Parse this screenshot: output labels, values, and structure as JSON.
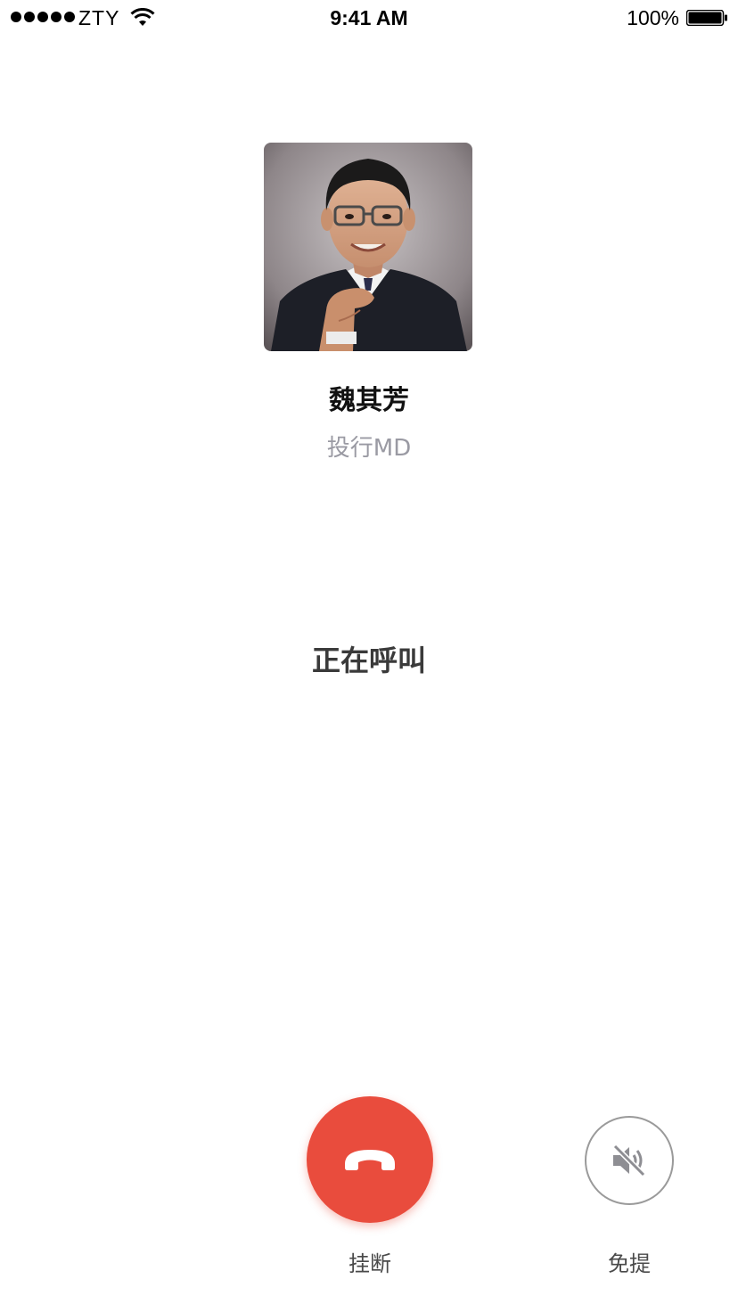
{
  "status_bar": {
    "carrier": "ZTY",
    "time": "9:41 AM",
    "battery_percent": "100%",
    "signal_bars": 5,
    "battery_level": 1.0,
    "icons": [
      "signal-icon",
      "wifi-icon",
      "battery-icon"
    ]
  },
  "caller": {
    "name": "魏其芳",
    "title": "投行MD",
    "avatar": "avatar-photo"
  },
  "call": {
    "status": "正在呼叫"
  },
  "controls": {
    "hangup_label": "挂断",
    "speaker_label": "免提",
    "hangup_icon": "phone-hangup-icon",
    "speaker_icon": "speaker-muted-icon"
  },
  "colors": {
    "hangup_red": "#e94c3d",
    "subtitle_gray": "#9a9aa3",
    "speaker_border": "#9a9a9a"
  }
}
